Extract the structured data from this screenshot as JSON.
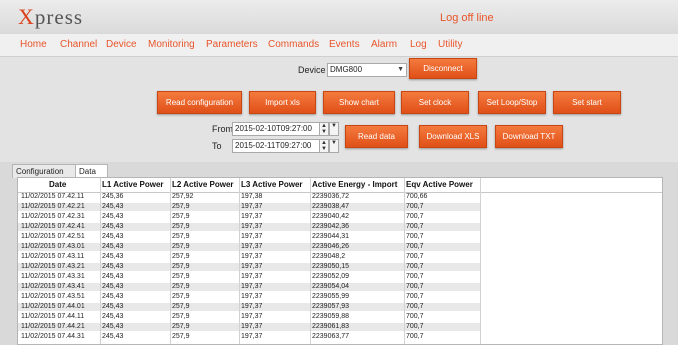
{
  "app": {
    "logo_x": "X",
    "logo_rest": "press",
    "status": "Log off line"
  },
  "menu": [
    "Home",
    "Channel",
    "Device",
    "Monitoring",
    "Parameters",
    "Commands",
    "Events",
    "Alarm",
    "Log",
    "Utility"
  ],
  "device": {
    "label": "Device",
    "value": "DMG800"
  },
  "buttons": {
    "disconnect": "Disconnect",
    "read_configuration": "Read configuration",
    "import_xls": "Import xls",
    "show_chart": "Show chart",
    "set_clock": "Set clock",
    "set_loop_stop": "Set Loop/Stop",
    "set_start": "Set start",
    "read_data": "Read data",
    "download_xls": "Download XLS",
    "download_txt": "Download TXT"
  },
  "range": {
    "from_label": "From",
    "from_value": "2015-02-10T09:27:00",
    "to_label": "To",
    "to_value": "2015-02-11T09:27:00"
  },
  "tabs": [
    "Configuration",
    "Data"
  ],
  "active_tab": "Data",
  "table": {
    "columns": [
      "Date",
      "L1 Active Power",
      "L2 Active Power",
      "L3 Active Power",
      "Active Energy - Import",
      "Eqv Active Power"
    ],
    "rows": [
      [
        "11/02/2015 07.42.11",
        "245,36",
        "257,92",
        "197,38",
        "2239036,72",
        "700,66"
      ],
      [
        "11/02/2015 07.42.21",
        "245,43",
        "257,9",
        "197,37",
        "2239038,47",
        "700,7"
      ],
      [
        "11/02/2015 07.42.31",
        "245,43",
        "257,9",
        "197,37",
        "2239040,42",
        "700,7"
      ],
      [
        "11/02/2015 07.42.41",
        "245,43",
        "257,9",
        "197,37",
        "2239042,36",
        "700,7"
      ],
      [
        "11/02/2015 07.42.51",
        "245,43",
        "257,9",
        "197,37",
        "2239044,31",
        "700,7"
      ],
      [
        "11/02/2015 07.43.01",
        "245,43",
        "257,9",
        "197,37",
        "2239046,26",
        "700,7"
      ],
      [
        "11/02/2015 07.43.11",
        "245,43",
        "257,9",
        "197,37",
        "2239048,2",
        "700,7"
      ],
      [
        "11/02/2015 07.43.21",
        "245,43",
        "257,9",
        "197,37",
        "2239050,15",
        "700,7"
      ],
      [
        "11/02/2015 07.43.31",
        "245,43",
        "257,9",
        "197,37",
        "2239052,09",
        "700,7"
      ],
      [
        "11/02/2015 07.43.41",
        "245,43",
        "257,9",
        "197,37",
        "2239054,04",
        "700,7"
      ],
      [
        "11/02/2015 07.43.51",
        "245,43",
        "257,9",
        "197,37",
        "2239055,99",
        "700,7"
      ],
      [
        "11/02/2015 07.44.01",
        "245,43",
        "257,9",
        "197,37",
        "2239057,93",
        "700,7"
      ],
      [
        "11/02/2015 07.44.11",
        "245,43",
        "257,9",
        "197,37",
        "2239059,88",
        "700,7"
      ],
      [
        "11/02/2015 07.44.21",
        "245,43",
        "257,9",
        "197,37",
        "2239061,83",
        "700,7"
      ],
      [
        "11/02/2015 07.44.31",
        "245,43",
        "257,9",
        "197,37",
        "2239063,77",
        "700,7"
      ]
    ]
  }
}
